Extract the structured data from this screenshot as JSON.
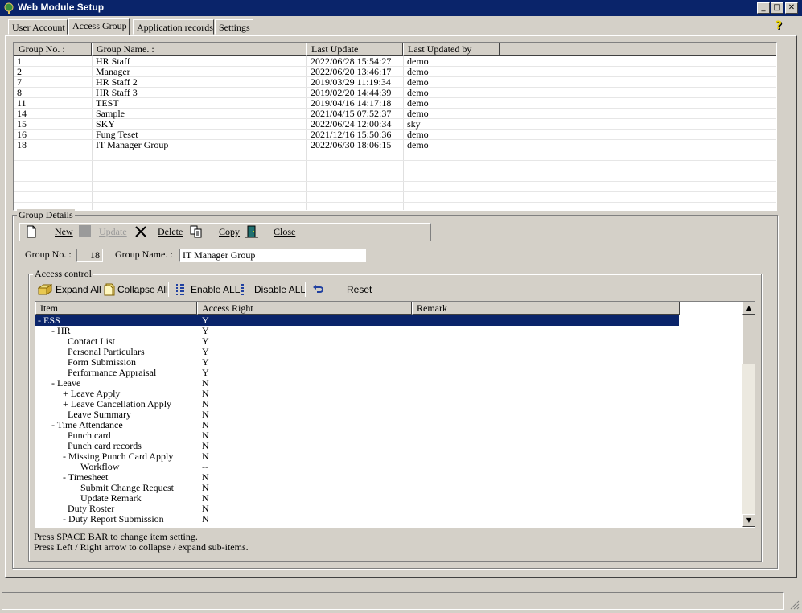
{
  "window": {
    "title": "Web Module Setup"
  },
  "tabs": [
    {
      "label": "User Account"
    },
    {
      "label": "Access Group"
    },
    {
      "label": "Application records"
    },
    {
      "label": "Settings"
    }
  ],
  "group_list": {
    "columns": [
      "Group No. :",
      "Group Name. :",
      "Last Update",
      "Last Updated by"
    ],
    "rows": [
      {
        "no": "1",
        "name": "HR Staff",
        "update": "2022/06/28 15:54:27",
        "by": "demo"
      },
      {
        "no": "2",
        "name": "Manager",
        "update": "2022/06/20 13:46:17",
        "by": "demo"
      },
      {
        "no": "7",
        "name": "HR Staff 2",
        "update": "2019/03/29 11:19:34",
        "by": "demo"
      },
      {
        "no": "8",
        "name": "HR Staff 3",
        "update": "2019/02/20 14:44:39",
        "by": "demo"
      },
      {
        "no": "11",
        "name": "TEST",
        "update": "2019/04/16 14:17:18",
        "by": "demo"
      },
      {
        "no": "14",
        "name": "Sample",
        "update": "2021/04/15 07:52:37",
        "by": "demo"
      },
      {
        "no": "15",
        "name": "SKY",
        "update": "2022/06/24 12:00:34",
        "by": "sky"
      },
      {
        "no": "16",
        "name": "Fung Teset",
        "update": "2021/12/16 15:50:36",
        "by": "demo"
      },
      {
        "no": "18",
        "name": "IT Manager Group",
        "update": "2022/06/30 18:06:15",
        "by": "demo"
      }
    ]
  },
  "details": {
    "title": "Group Details",
    "toolbar": {
      "new": "New",
      "update": "Update",
      "delete": "Delete",
      "copy": "Copy",
      "close": "Close"
    },
    "group_no_label": "Group No. :",
    "group_no_value": "18",
    "group_name_label": "Group Name. :",
    "group_name_value": "IT Manager Group"
  },
  "access_control": {
    "title": "Access control",
    "buttons": {
      "expand": "Expand All",
      "collapse": "Collapse All",
      "enable": "Enable ALL",
      "disable": "Disable ALL",
      "reset": "Reset"
    },
    "columns": [
      "Item",
      "Access Right",
      "Remark"
    ],
    "items": [
      {
        "label": "- ESS",
        "right": "Y",
        "selected": true
      },
      {
        "label": "- HR",
        "right": "Y"
      },
      {
        "label": "Contact List",
        "right": "Y"
      },
      {
        "label": "Personal Particulars",
        "right": "Y"
      },
      {
        "label": "Form Submission",
        "right": "Y"
      },
      {
        "label": "Performance Appraisal",
        "right": "Y"
      },
      {
        "label": "- Leave",
        "right": "N"
      },
      {
        "label": "+ Leave Apply",
        "right": "N"
      },
      {
        "label": "+ Leave Cancellation Apply",
        "right": "N"
      },
      {
        "label": "Leave Summary",
        "right": "N"
      },
      {
        "label": "- Time Attendance",
        "right": "N"
      },
      {
        "label": "Punch card",
        "right": "N"
      },
      {
        "label": "Punch card records",
        "right": "N"
      },
      {
        "label": "- Missing Punch Card Apply",
        "right": "N"
      },
      {
        "label": "Workflow",
        "right": "--"
      },
      {
        "label": "- Timesheet",
        "right": "N"
      },
      {
        "label": "Submit Change Request",
        "right": "N"
      },
      {
        "label": "Update Remark",
        "right": "N"
      },
      {
        "label": "Duty Roster",
        "right": "N"
      },
      {
        "label": "- Duty Report Submission",
        "right": "N"
      }
    ],
    "hint1": "Press SPACE BAR to change item setting.",
    "hint2": "Press Left / Right arrow to collapse / expand sub-items."
  }
}
